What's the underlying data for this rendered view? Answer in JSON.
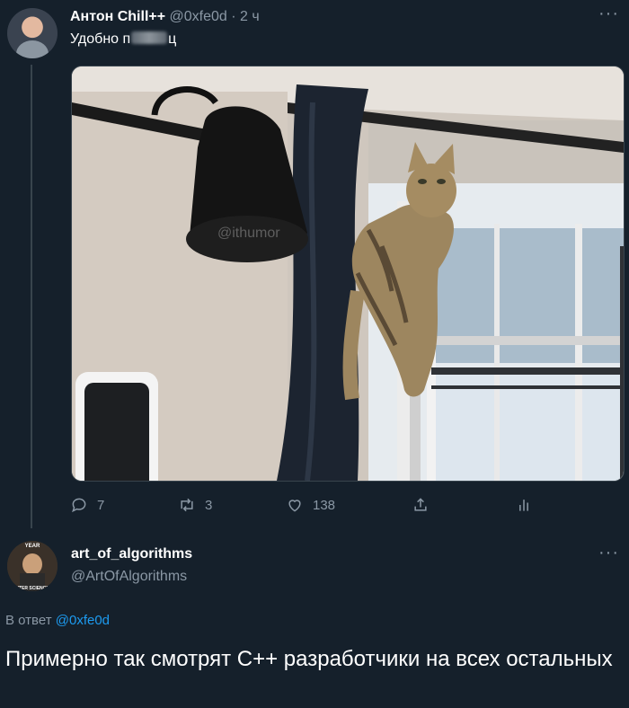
{
  "tweet": {
    "author_name": "Антон Chill++",
    "author_handle": "@0xfe0d",
    "separator": "·",
    "time": "2 ч",
    "text_start": "Удобно п",
    "text_end": "ц",
    "image_watermark": "@ithumor",
    "replies": "7",
    "retweets": "3",
    "likes": "138"
  },
  "reply": {
    "author_name": "art_of_algorithms",
    "author_handle": "@ArtOfAlgorithms",
    "avatar_text_top": "YEAR",
    "avatar_text_bottom": "UTER SCIENCE",
    "reply_prefix": "В ответ",
    "reply_mention": "@0xfe0d",
    "text": "Примерно так смотрят C++ разработчики на всех остальных"
  },
  "icons": {
    "more": "more-horizontal-icon",
    "reply": "reply-icon",
    "retweet": "retweet-icon",
    "like": "heart-icon",
    "share": "share-icon",
    "analytics": "analytics-icon"
  },
  "colors": {
    "background": "#15202b",
    "text": "#ffffff",
    "secondary": "#8b98a5",
    "link": "#1d9bf0"
  }
}
